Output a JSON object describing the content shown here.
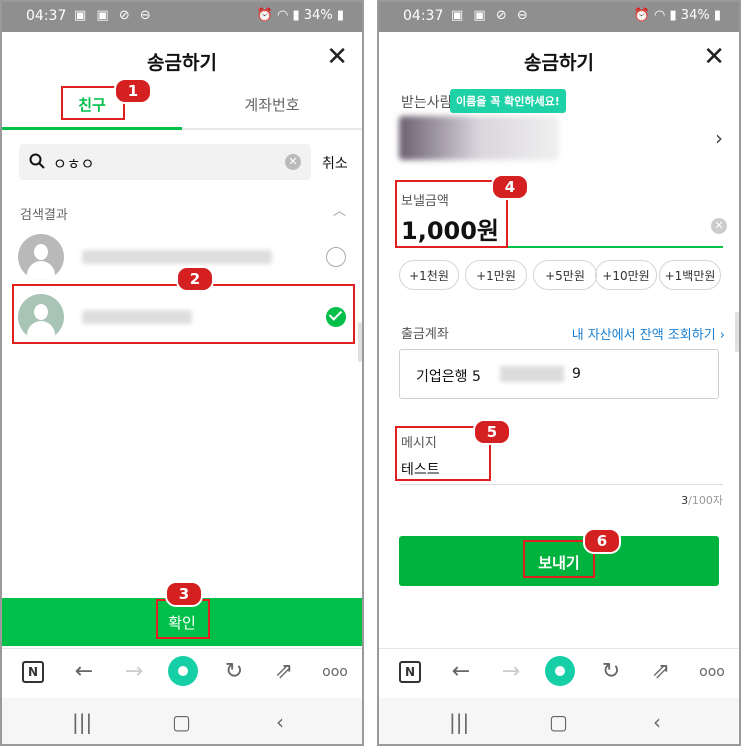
{
  "status": {
    "time": "04:37",
    "battery": "34%"
  },
  "screen1": {
    "title": "송금하기",
    "tabs": [
      {
        "label": "친구"
      },
      {
        "label": "계좌번호"
      }
    ],
    "search": {
      "query": "ㅇㅎㅇ",
      "cancel": "취소"
    },
    "results_label": "검색결과",
    "confirm_label": "확인"
  },
  "screen2": {
    "title": "송금하기",
    "receiver_label": "받는사람",
    "tooltip": "이름을 꼭 확인하세요!",
    "amount_label": "보낼금액",
    "amount": "1,000원",
    "chips": [
      "+1천원",
      "+1만원",
      "+5만원",
      "+10만원",
      "+1백만원"
    ],
    "account_label": "출금계좌",
    "account_link": "내 자산에서 잔액 조회하기 ›",
    "account_bank": "기업은행 5",
    "account_last": "9",
    "message_label": "메시지",
    "message": "테스트",
    "counter_current": "3",
    "counter_max": "/100자",
    "send_label": "보내기"
  },
  "badges": [
    "1",
    "2",
    "3",
    "4",
    "5",
    "6"
  ],
  "colors": {
    "accent": "#00c04a",
    "callout": "#e02020",
    "tooltip": "#1fd1a7",
    "link": "#1a7fd0"
  }
}
